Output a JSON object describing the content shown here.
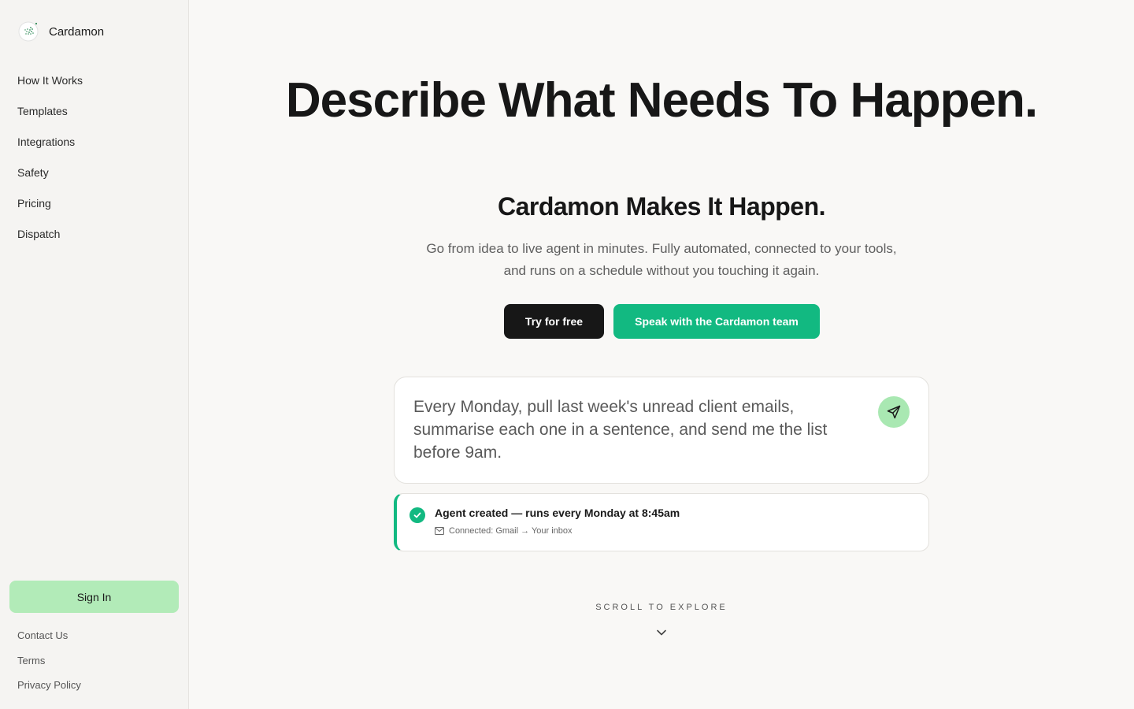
{
  "brand": {
    "name": "Cardamon",
    "logo_icon": "dotted-sphere-icon"
  },
  "sidebar": {
    "nav": [
      {
        "label": "How It Works"
      },
      {
        "label": "Templates"
      },
      {
        "label": "Integrations"
      },
      {
        "label": "Safety"
      },
      {
        "label": "Pricing"
      },
      {
        "label": "Dispatch"
      }
    ],
    "sign_in_label": "Sign In",
    "footer_links": [
      {
        "label": "Contact Us"
      },
      {
        "label": "Terms"
      },
      {
        "label": "Privacy Policy"
      }
    ]
  },
  "hero": {
    "headline": "Describe What Needs To Happen.",
    "subheadline": "Cardamon Makes It Happen.",
    "description": "Go from idea to live agent in minutes. Fully automated, connected to your tools, and runs on a schedule without you touching it again.",
    "primary_cta": "Try for free",
    "secondary_cta": "Speak with the Cardamon team"
  },
  "prompt": {
    "text": "Every Monday, pull last week's unread client emails, summarise each one in a sentence, and send me the list before 9am.",
    "send_icon": "send-icon"
  },
  "status": {
    "title": "Agent created — runs every Monday at 8:45am",
    "detail": "Connected: Gmail → Your inbox",
    "icon": "check-circle-icon",
    "detail_icon": "mail-icon"
  },
  "scroll_hint": "SCROLL TO EXPLORE",
  "colors": {
    "accent_green": "#12b981",
    "light_green": "#b2ebb8",
    "dark": "#171717",
    "background": "#f9f8f6"
  }
}
